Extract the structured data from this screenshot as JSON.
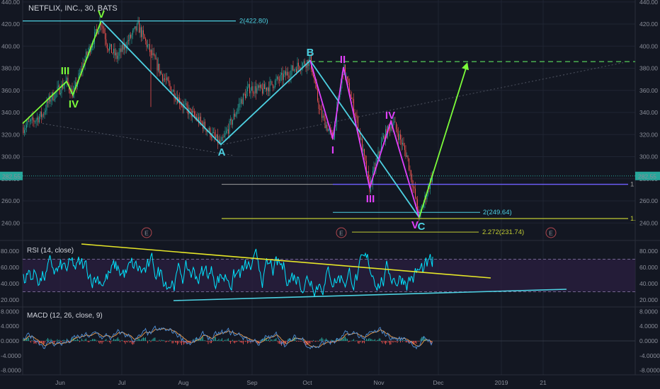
{
  "title": "NETFLIX, INC., 30, BATS",
  "price_tag": "282.55",
  "rsi_label": "RSI (14, close)",
  "macd_label": "MACD (12, 26, close, 9)",
  "x_labels": [
    "Jun",
    "Jul",
    "Aug",
    "Sep",
    "Oct",
    "Nov",
    "Dec",
    "2019",
    "21"
  ],
  "earnings_marker": "E",
  "fib_labels": {
    "level_422": "2(422.80)",
    "level_249": "2(249.64)",
    "level_231": "2.272(231.74)",
    "level_one_a": "1",
    "level_one_b": "1."
  },
  "wave_labels": {
    "main_III": "III",
    "main_IV": "IV",
    "main_V": "V",
    "A": "A",
    "B": "B",
    "C": "C",
    "sub_I": "I",
    "sub_II": "II",
    "sub_III": "III",
    "sub_IV": "IV",
    "sub_V": "V"
  },
  "colors": {
    "background": "#131722",
    "up": "#26a69a",
    "down": "#ef5350",
    "cyan": "#4dd0e1",
    "green": "#7cfc3a",
    "magenta": "#e040fb",
    "yellow": "#e6e628",
    "rsi": "#00e5ff",
    "macd": "#4f8fd6",
    "signal": "#f0a050"
  },
  "chart_data": [
    {
      "type": "line",
      "title": "NETFLIX, INC., 30, BATS",
      "y_ticks": [
        240,
        260,
        280,
        300,
        320,
        340,
        360,
        380,
        400,
        420,
        440
      ],
      "ylim": [
        230,
        440
      ],
      "last_price": 282.55,
      "wave_points": [
        {
          "label": "III",
          "price": 368
        },
        {
          "label": "IV",
          "price": 355
        },
        {
          "label": "V",
          "price": 423
        },
        {
          "label": "A",
          "price": 311
        },
        {
          "label": "B",
          "price": 387
        },
        {
          "label": "I",
          "price": 316
        },
        {
          "label": "II",
          "price": 381
        },
        {
          "label": "III",
          "price": 272
        },
        {
          "label": "IV",
          "price": 332
        },
        {
          "label": "V",
          "price": 245
        },
        {
          "label": "C",
          "price": 245
        }
      ],
      "projection_target": 386,
      "fib_levels": [
        {
          "label": "2(422.80)",
          "price": 422.8
        },
        {
          "label": "2(249.64)",
          "price": 249.64
        },
        {
          "label": "2.272(231.74)",
          "price": 231.74
        }
      ],
      "grid": true
    },
    {
      "type": "line",
      "title": "RSI (14, close)",
      "y_ticks": [
        20,
        40,
        60,
        80
      ],
      "ylim": [
        12,
        88
      ],
      "bands": [
        30,
        70
      ]
    },
    {
      "type": "line",
      "title": "MACD (12, 26, close, 9)",
      "y_ticks": [
        -8,
        -4,
        0,
        4,
        8
      ],
      "ylim": [
        -9.5,
        9.5
      ]
    }
  ]
}
